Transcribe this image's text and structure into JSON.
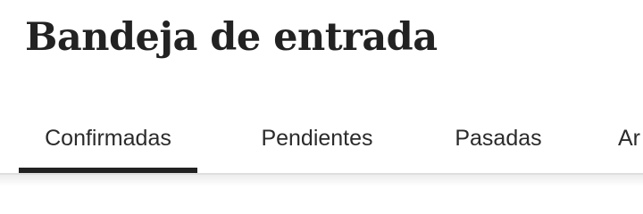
{
  "header": {
    "title": "Bandeja de entrada"
  },
  "tabs": [
    {
      "label": "Confirmadas",
      "active": true
    },
    {
      "label": "Pendientes",
      "active": false
    },
    {
      "label": "Pasadas",
      "active": false
    },
    {
      "label": "Ar",
      "active": false
    }
  ],
  "colors": {
    "text": "#222222",
    "active_indicator": "#222222",
    "divider": "#dedede",
    "background": "#ffffff"
  }
}
